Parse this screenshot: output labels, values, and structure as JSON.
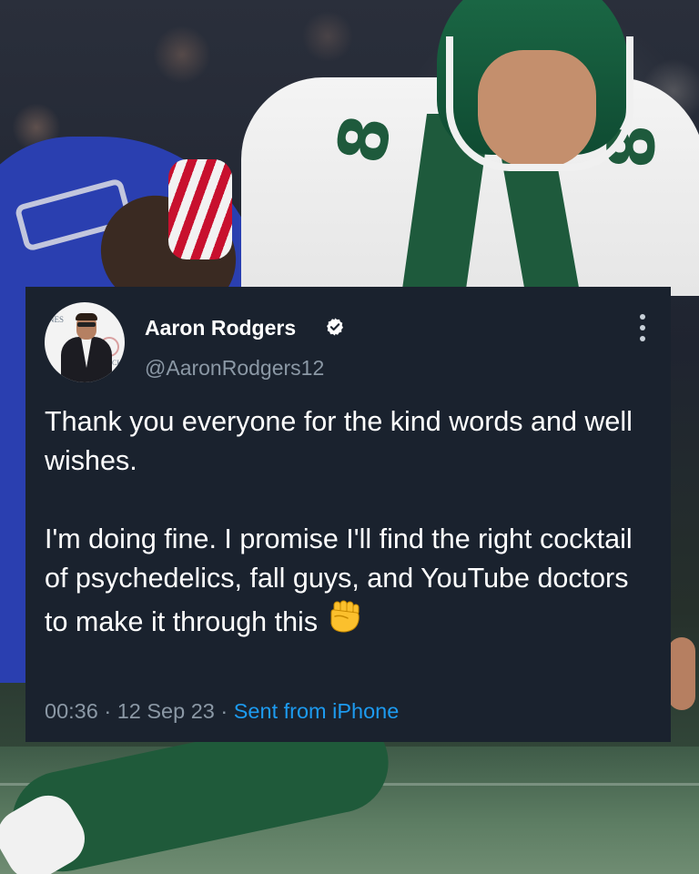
{
  "tweet": {
    "display_name": "Aaron Rodgers",
    "handle": "@AaronRodgers12",
    "verified": true,
    "text": "Thank you everyone for the kind words and well wishes.\n\nI'm doing fine. I promise I'll find the right cocktail of psychedelics, fall guys, and YouTube doctors to make it through this ",
    "emoji": "✊",
    "time": "00:36",
    "date": "12 Sep 23",
    "separator": " · ",
    "source": "Sent from iPhone"
  },
  "avatar_text": {
    "left": "NES",
    "right": "CKY"
  },
  "jersey_number": "8",
  "colors": {
    "card_background": "#1a222e",
    "primary_text": "#ffffff",
    "secondary_text": "#8b98a5",
    "link": "#1d9bf0",
    "jets_green": "#1e5a3c",
    "bills_blue": "#2a3fb0"
  },
  "icons": [
    "verified-badge-icon",
    "more-options-icon",
    "raised-fist-emoji"
  ]
}
